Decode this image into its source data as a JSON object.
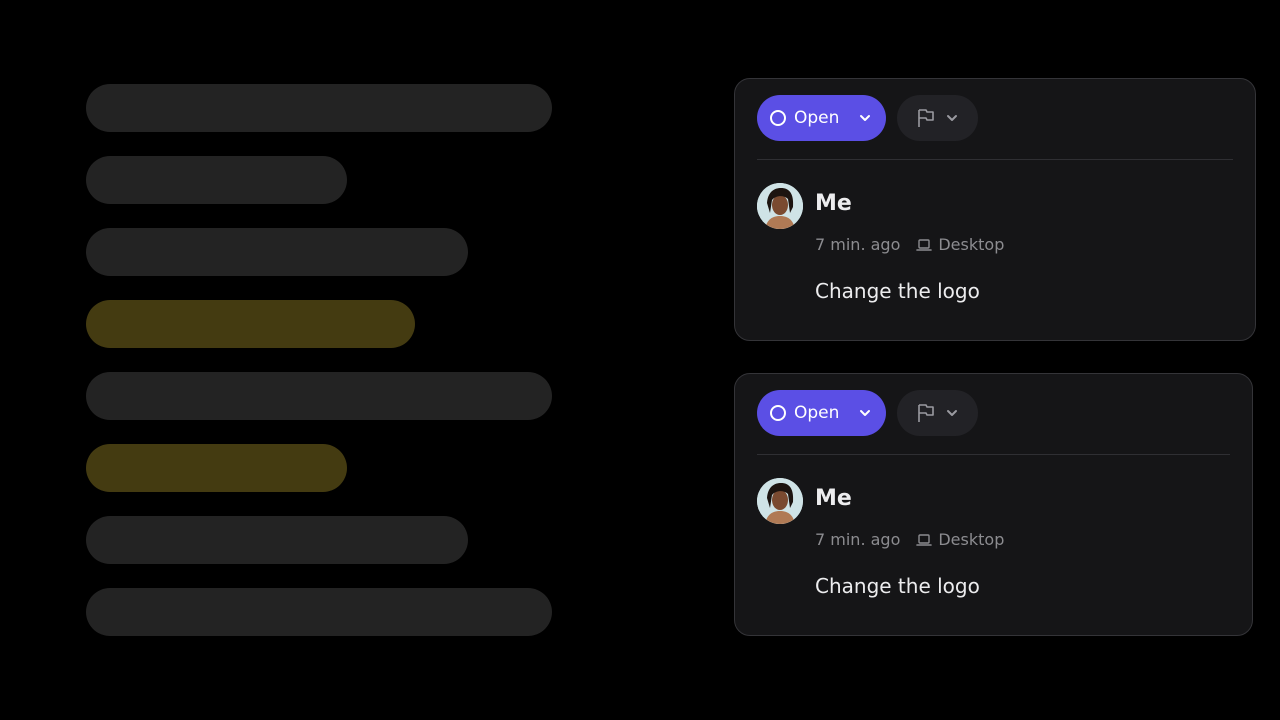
{
  "skeleton_bars": [
    {
      "highlighted": false
    },
    {
      "highlighted": false
    },
    {
      "highlighted": false
    },
    {
      "highlighted": true
    },
    {
      "highlighted": false
    },
    {
      "highlighted": true
    },
    {
      "highlighted": false
    },
    {
      "highlighted": false
    }
  ],
  "colors": {
    "background": "#000000",
    "bar": "#232323",
    "bar_highlight": "#443b11",
    "card": "#151517",
    "accent": "#5b4fe5"
  },
  "cards": [
    {
      "status_label": "Open",
      "status_icon": "circle-icon",
      "flag_icon": "flag-icon",
      "author": "Me",
      "time": "7 min. ago",
      "device_icon": "laptop-icon",
      "device": "Desktop",
      "message": "Change the logo"
    },
    {
      "status_label": "Open",
      "status_icon": "circle-icon",
      "flag_icon": "flag-icon",
      "author": "Me",
      "time": "7 min. ago",
      "device_icon": "laptop-icon",
      "device": "Desktop",
      "message": "Change the logo"
    }
  ]
}
